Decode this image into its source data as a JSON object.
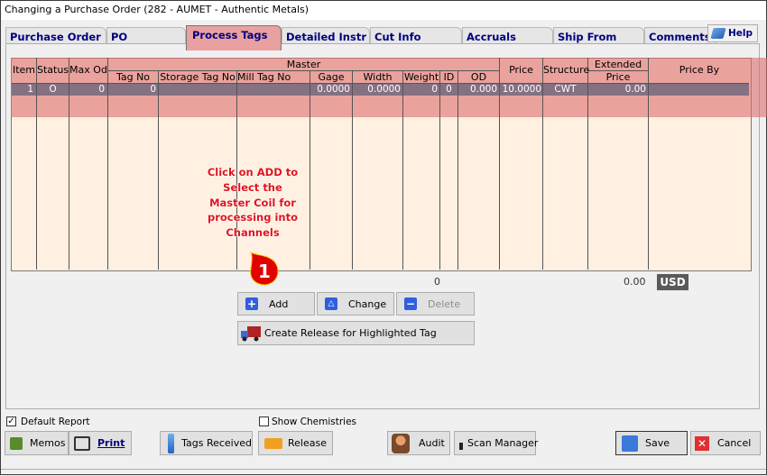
{
  "window": {
    "title": "Changing a Purchase Order  (282 - AUMET - Authentic Metals)"
  },
  "tabs": [
    {
      "label": "Purchase Order",
      "active": false
    },
    {
      "label": "PO Instructions",
      "active": false
    },
    {
      "label": "Process Tags",
      "active": true
    },
    {
      "label": "Detailed Instr",
      "active": false
    },
    {
      "label": "Cut Info",
      "active": false
    },
    {
      "label": "Accruals",
      "active": false
    },
    {
      "label": "Ship From",
      "active": false
    },
    {
      "label": "Comments",
      "active": false
    }
  ],
  "help": {
    "label": "Help",
    "icon": "help-book-icon"
  },
  "grid": {
    "group_header": "Master",
    "columns": {
      "item": "Item",
      "status": "Status",
      "max_od": "Max Od",
      "tag_no": "Tag No",
      "storage_tag_no": "Storage Tag No",
      "mill_tag_no": "Mill Tag No",
      "gage": "Gage",
      "width": "Width",
      "weight": "Weight",
      "id": "ID",
      "od": "OD",
      "price": "Price",
      "structure": "Structure",
      "extended_price_1": "Extended",
      "extended_price_2": "Price",
      "price_by": "Price By"
    },
    "rows": [
      {
        "item": "1",
        "status": "O",
        "max_od": "0",
        "tag_no": "0",
        "storage_tag_no": "",
        "mill_tag_no": "",
        "gage": "0.0000",
        "width": "0.0000",
        "weight": "0",
        "id": "0",
        "od": "0.000",
        "price": "10.0000",
        "structure": "CWT",
        "extended_price": "0.00",
        "price_by": ""
      }
    ]
  },
  "callout": {
    "text_lines": [
      "Click on ADD to",
      "Select the",
      "Master Coil for",
      "processing into",
      "Channels"
    ],
    "badge": "1",
    "color": "#e0141e"
  },
  "totals": {
    "weight_total": "0",
    "extended_total": "0.00",
    "currency": "USD"
  },
  "actions": {
    "add": "Add",
    "change": "Change",
    "delete": "Delete",
    "create_release": "Create Release for Highlighted Tag"
  },
  "footer": {
    "default_report": {
      "label": "Default Report",
      "checked": true
    },
    "show_chemistries": {
      "label": "Show Chemistries",
      "checked": false
    },
    "memos": "Memos",
    "print": "Print",
    "tags_received": "Tags Received",
    "release": "Release",
    "audit": "Audit",
    "scan_manager": "Scan Manager",
    "save": "Save",
    "cancel": "Cancel"
  }
}
